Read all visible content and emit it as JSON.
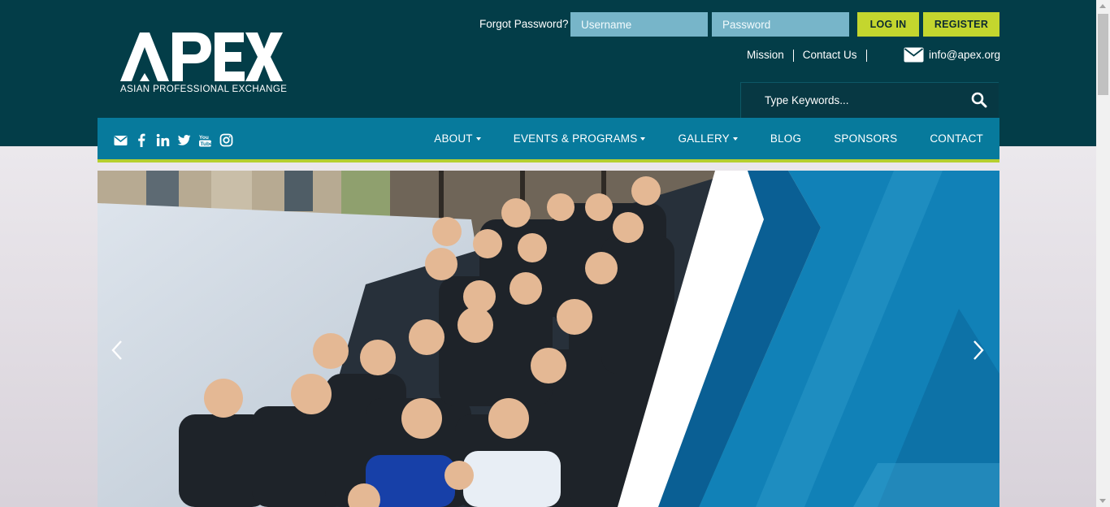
{
  "logo": {
    "mark": "APEX",
    "tagline": "ASIAN PROFESSIONAL EXCHANGE"
  },
  "auth": {
    "forgot_label": "Forgot Password?",
    "username_placeholder": "Username",
    "password_placeholder": "Password",
    "login_label": "LOG IN",
    "register_label": "REGISTER"
  },
  "sublinks": [
    {
      "label": "Mission"
    },
    {
      "label": "Contact Us"
    }
  ],
  "email": {
    "label": "info@apex.org",
    "icon": "envelope-icon"
  },
  "search": {
    "placeholder": "Type Keywords...",
    "icon": "search-icon"
  },
  "social": [
    "envelope-icon",
    "facebook-icon",
    "linkedin-icon",
    "twitter-icon",
    "youtube-icon",
    "instagram-icon"
  ],
  "nav": {
    "items": [
      {
        "label": "ABOUT",
        "has_dropdown": true
      },
      {
        "label": "EVENTS & PROGRAMS",
        "has_dropdown": true
      },
      {
        "label": "GALLERY",
        "has_dropdown": true
      },
      {
        "label": "BLOG",
        "has_dropdown": false
      },
      {
        "label": "SPONSORS",
        "has_dropdown": false
      },
      {
        "label": "CONTACT",
        "has_dropdown": false
      }
    ]
  },
  "hero": {
    "prev_icon": "chevron-left-icon",
    "next_icon": "chevron-right-icon"
  },
  "colors": {
    "header_bg": "#033d48",
    "nav_bg": "#077a9c",
    "accent_green": "#c4d62e",
    "input_bg": "#77b5c9",
    "hero_blue": "#1181b7"
  }
}
